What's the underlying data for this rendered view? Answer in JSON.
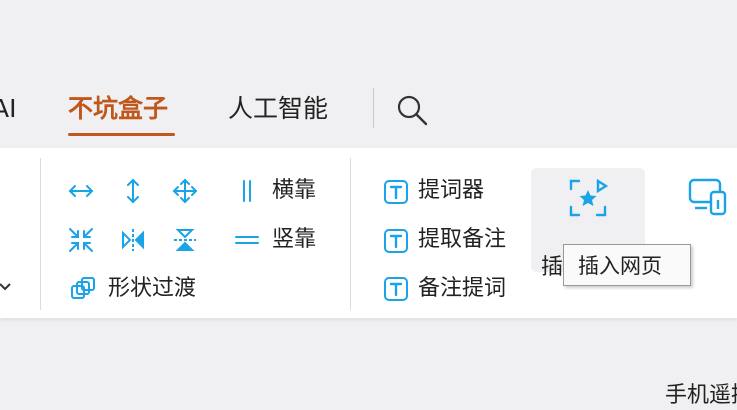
{
  "tabs": [
    {
      "label": "AI"
    },
    {
      "label": "不坑盒子"
    },
    {
      "label": "人工智能"
    }
  ],
  "ribbon": {
    "align_group": {
      "horizontal_label": "横靠",
      "vertical_label": "竖靠",
      "shape_transition_label": "形状过渡"
    },
    "note_group": {
      "prompt_words_label": "提词器",
      "extract_notes_label": "提取备注",
      "note_prompt_label": "备注提词"
    },
    "insert_webpage_label": "插入网页",
    "remote_label": "手机遥控"
  },
  "tooltip": {
    "text": "插入网页"
  },
  "colors": {
    "accent": "#c0581e",
    "icon": "#1aa3e6"
  }
}
